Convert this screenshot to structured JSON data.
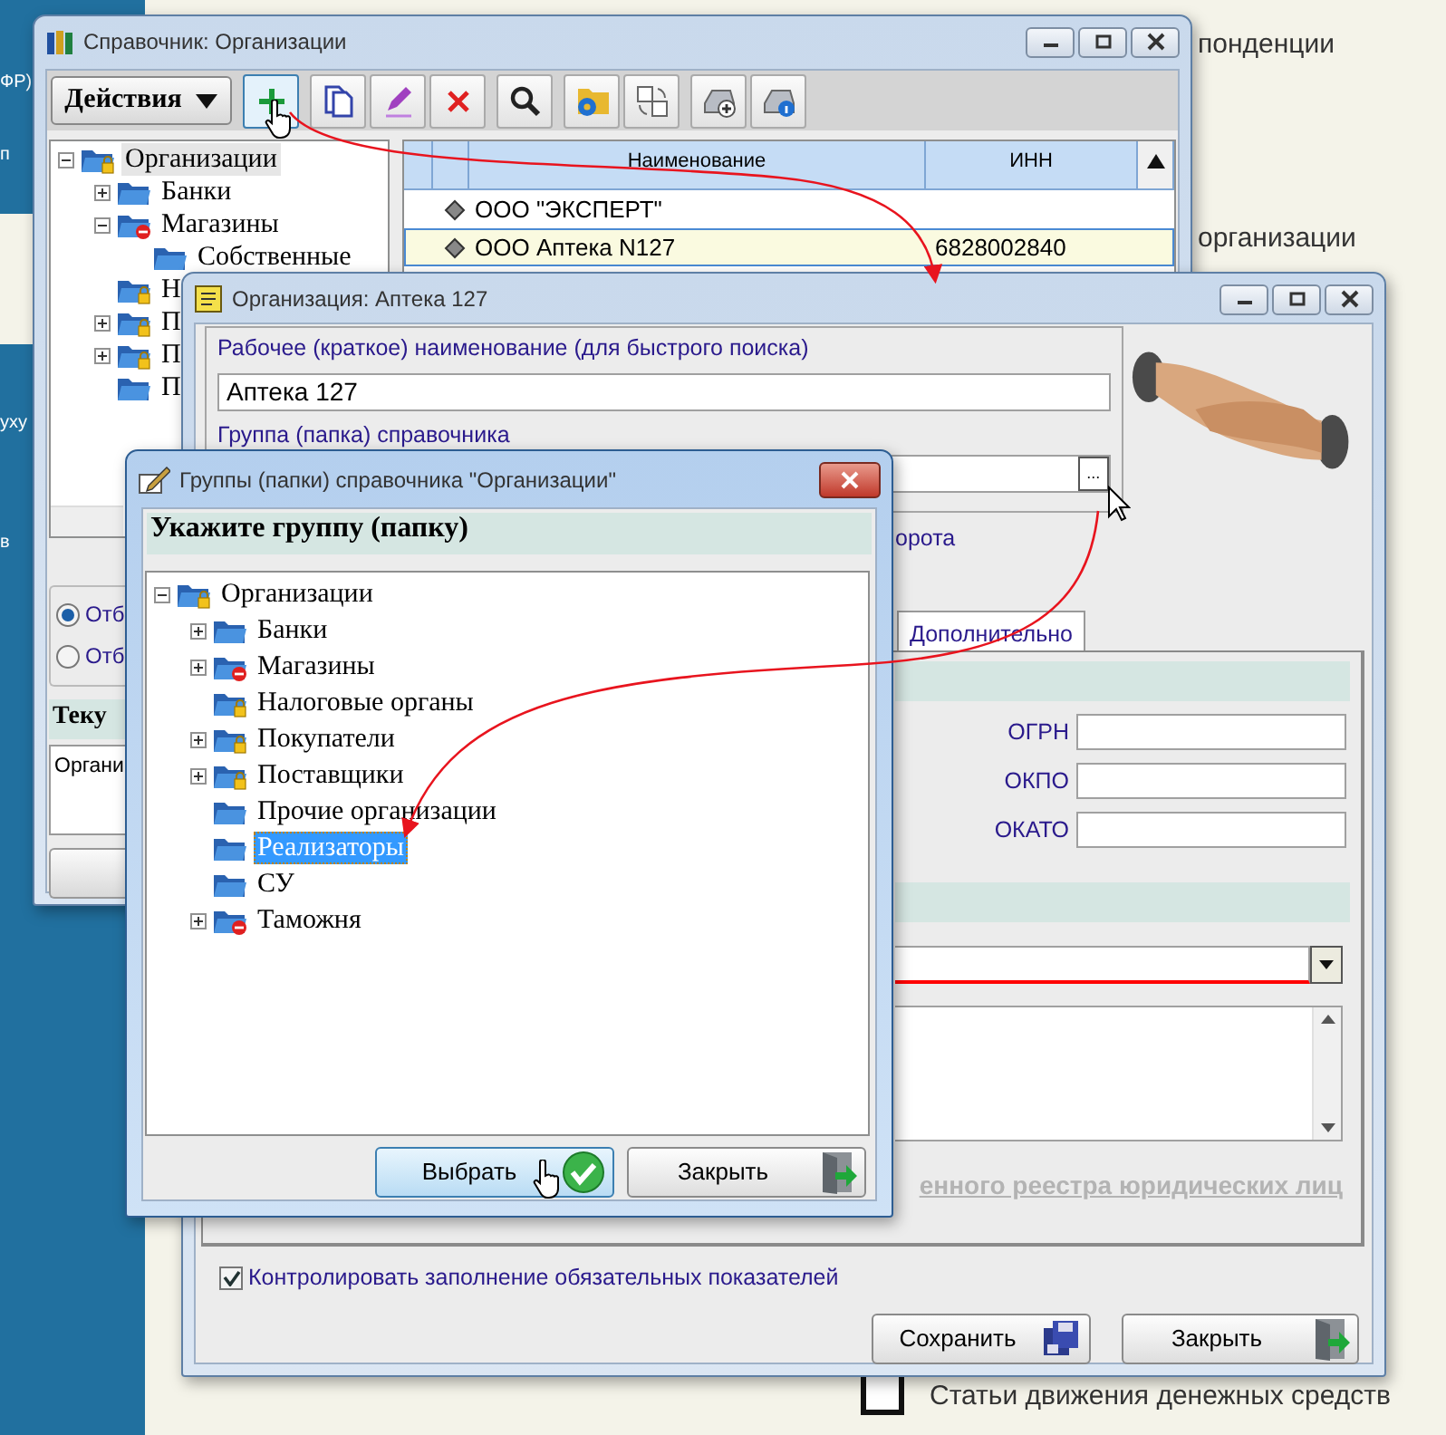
{
  "background": {
    "left_texts": [
      "ФР)",
      "п",
      "уху",
      "в"
    ],
    "right_texts": [
      "понденции",
      "организации"
    ],
    "list_item": {
      "label": "Статьи движения денежных средств",
      "checked": false
    }
  },
  "directory_window": {
    "title": "Справочник: Организации",
    "actions_button": "Действия",
    "toolbar": [
      {
        "kind": "add",
        "hovered": true
      },
      {
        "kind": "copy",
        "hovered": false
      },
      {
        "kind": "edit",
        "hovered": false
      },
      {
        "kind": "delete",
        "hovered": false
      },
      {
        "kind": "search",
        "hovered": false
      },
      {
        "kind": "folder-gear",
        "hovered": false
      },
      {
        "kind": "swap",
        "hovered": false
      },
      {
        "kind": "drive-add",
        "hovered": false
      },
      {
        "kind": "drive-info",
        "hovered": false
      }
    ],
    "tree": [
      {
        "label": "Организации",
        "kind": "lock",
        "expanded": true,
        "selected": true,
        "children": [
          {
            "label": "Банки",
            "kind": "plain",
            "expanded": false,
            "selected": false
          },
          {
            "label": "Магазины",
            "kind": "stop",
            "expanded": true,
            "selected": false,
            "children": [
              {
                "label": "Собственные",
                "kind": "plain",
                "selected": false
              }
            ]
          },
          {
            "label": "Н",
            "kind": "lock",
            "selected": false
          },
          {
            "label": "П",
            "kind": "lock",
            "expanded": false,
            "selected": false
          },
          {
            "label": "П",
            "kind": "lock",
            "expanded": false,
            "selected": false
          },
          {
            "label": "П",
            "kind": "plain",
            "selected": false
          }
        ]
      }
    ],
    "grid": {
      "columns": [
        "Наименование",
        "ИНН"
      ],
      "rows": [
        {
          "name": "ООО \"ЭКСПЕРТ\"",
          "selected": false
        },
        {
          "name": "ООО Аптека N127",
          "inn": "6828002840",
          "selected": true
        }
      ]
    },
    "radios": [
      {
        "label": "Отб",
        "selected": true
      },
      {
        "label": "Отб",
        "selected": false
      }
    ],
    "current_header": "Теку",
    "current_value": "Органи"
  },
  "organization_window": {
    "title": "Организация: Аптека 127",
    "short_name_label": "Рабочее (краткое) наименование (для быстрого поиска)",
    "short_name_value": "Аптека 127",
    "group_label": "Группа (папка) справочника",
    "browse_button": "...",
    "label_fragment": "орота",
    "tabs": [
      {
        "label": "Дополнительно",
        "selected": true
      }
    ],
    "codes": [
      {
        "label": "ОГРН"
      },
      {
        "label": "ОКПО"
      },
      {
        "label": "ОКАТО"
      }
    ],
    "link_fragment": "енного реестра юридических лиц",
    "control_required": {
      "label": "Контролировать заполнение обязательных показателей",
      "checked": true
    },
    "buttons": [
      {
        "kind": "save",
        "label": "Сохранить",
        "hovered": false
      },
      {
        "kind": "close",
        "label": "Закрыть",
        "hovered": false
      }
    ]
  },
  "groups_dialog": {
    "title": "Группы (папки) справочника \"Организации\"",
    "prompt": "Укажите группу (папку)",
    "tree": [
      {
        "label": "Организации",
        "kind": "lock",
        "expanded": true,
        "selected": false,
        "children": [
          {
            "label": "Банки",
            "kind": "plain",
            "expanded": false,
            "selected": false
          },
          {
            "label": "Магазины",
            "kind": "stop",
            "expanded": false,
            "selected": false
          },
          {
            "label": "Налоговые органы",
            "kind": "lock",
            "selected": false
          },
          {
            "label": "Покупатели",
            "kind": "lock",
            "expanded": false,
            "selected": false
          },
          {
            "label": "Поставщики",
            "kind": "lock",
            "expanded": false,
            "selected": false
          },
          {
            "label": "Прочие организации",
            "kind": "plain",
            "selected": false
          },
          {
            "label": "Реализаторы",
            "kind": "plain",
            "selected": true
          },
          {
            "label": "СУ",
            "kind": "plain",
            "selected": false
          },
          {
            "label": "Таможня",
            "kind": "stop",
            "expanded": false,
            "selected": false
          }
        ]
      }
    ],
    "buttons": [
      {
        "kind": "select",
        "label": "Выбрать",
        "hovered": true
      },
      {
        "kind": "close",
        "label": "Закрыть",
        "hovered": false
      }
    ]
  }
}
